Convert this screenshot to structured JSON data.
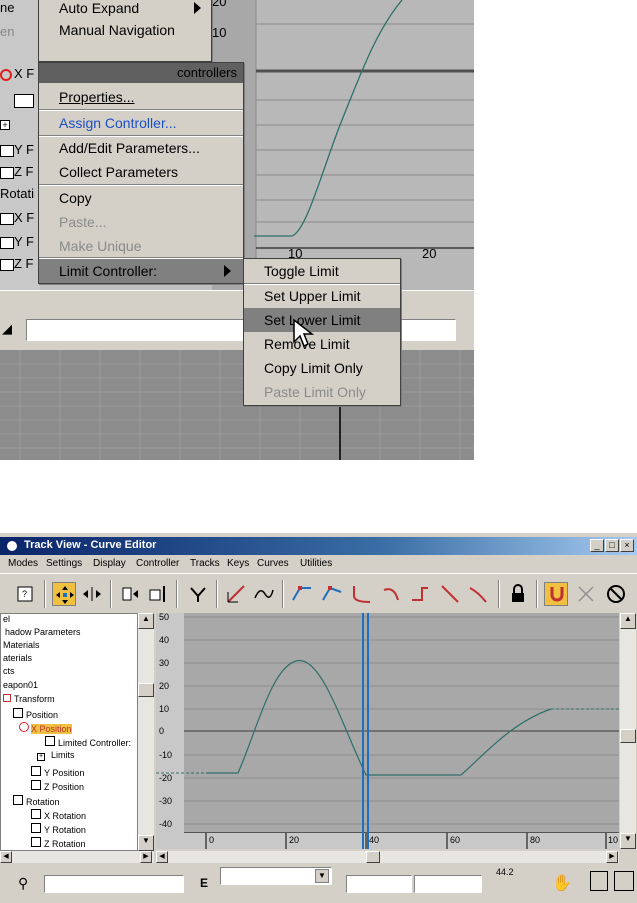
{
  "top": {
    "left_list": [
      {
        "text": "ne",
        "y": 0
      },
      {
        "text": "en",
        "y": 24
      }
    ],
    "tracks_partial": [
      "X F",
      "Y F",
      "Z F",
      "Rotati",
      "X F",
      "Y F",
      "Z F"
    ],
    "context_menu": {
      "items_top": [
        "Auto Expand",
        "Manual Navigation"
      ],
      "header": "controllers",
      "items": [
        {
          "label": "Properties...",
          "state": "normal"
        },
        {
          "label": "Assign Controller...",
          "state": "blue"
        },
        {
          "label": "Add/Edit Parameters...",
          "state": "normal"
        },
        {
          "label": "Collect Parameters",
          "state": "normal"
        },
        {
          "label": "Copy",
          "state": "normal"
        },
        {
          "label": "Paste...",
          "state": "disabled"
        },
        {
          "label": "Make Unique",
          "state": "disabled"
        },
        {
          "label": "Limit Controller:",
          "state": "highlight"
        }
      ]
    },
    "submenu": {
      "items": [
        {
          "label": "Toggle Limit",
          "state": "normal"
        },
        {
          "label": "Set Upper Limit",
          "state": "normal"
        },
        {
          "label": "Set Lower Limit",
          "state": "highlight"
        },
        {
          "label": "Remove Limit",
          "state": "normal"
        },
        {
          "label": "Copy Limit Only",
          "state": "normal"
        },
        {
          "label": "Paste Limit Only",
          "state": "disabled"
        }
      ]
    },
    "graph_labels": [
      "20",
      "10",
      "10",
      "20"
    ]
  },
  "window": {
    "title": "Track View - Curve Editor",
    "buttons": [
      "_",
      "□",
      "×"
    ],
    "menu": [
      "Modes",
      "Settings",
      "Display",
      "Controller",
      "Tracks",
      "Keys",
      "Curves",
      "Utilities"
    ],
    "tree": [
      "el",
      "hadow Parameters",
      "Materials",
      "aterials",
      "cts",
      "eapon01",
      "Transform",
      "Position",
      "X Position",
      "Limited Controller:",
      "Limits",
      "Y Position",
      "Z Position",
      "Rotation",
      "X Rotation",
      "Y Rotation",
      "Z Rotation"
    ],
    "y_ticks": [
      "50",
      "40",
      "30",
      "20",
      "10",
      "0",
      "-10",
      "-20",
      "-30",
      "-40"
    ],
    "x_ticks": [
      "0",
      "20",
      "40",
      "60",
      "80",
      "10"
    ],
    "status_letter": "E",
    "zoom_readout": "44.2"
  },
  "colors": {
    "curve": "#2e6f6a",
    "time_bar": "#1f6fbf",
    "menu_bg": "#d4d0c8",
    "highlight": "#808080"
  }
}
